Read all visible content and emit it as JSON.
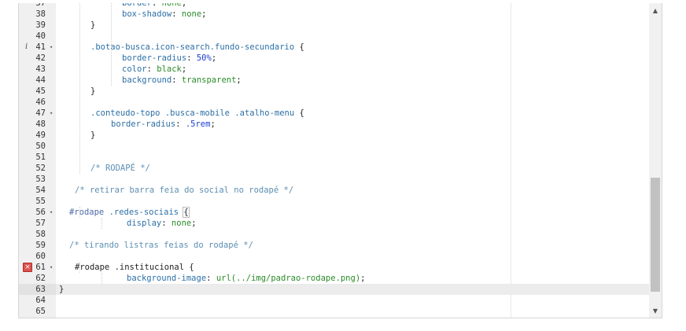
{
  "editor": {
    "first_line_partial": {
      "number": "37",
      "text": "border: none;"
    },
    "lines": [
      {
        "n": "38",
        "indent": 80,
        "tokens": [
          [
            "prop",
            "box-shadow"
          ],
          [
            "pun",
            ": "
          ],
          [
            "val",
            "none"
          ],
          [
            "pun",
            ";"
          ]
        ]
      },
      {
        "n": "39",
        "indent": 40,
        "tokens": [
          [
            "pun",
            "}"
          ]
        ]
      },
      {
        "n": "40",
        "indent": 0,
        "tokens": []
      },
      {
        "n": "41",
        "indent": 40,
        "fold": true,
        "info": true,
        "tokens": [
          [
            "sel",
            ".botao-busca.icon-search.fundo-secundario "
          ],
          [
            "pun",
            "{"
          ]
        ]
      },
      {
        "n": "42",
        "indent": 80,
        "tokens": [
          [
            "prop",
            "border-radius"
          ],
          [
            "pun",
            ": "
          ],
          [
            "num",
            "50%"
          ],
          [
            "pun",
            ";"
          ]
        ]
      },
      {
        "n": "43",
        "indent": 80,
        "tokens": [
          [
            "prop",
            "color"
          ],
          [
            "pun",
            ": "
          ],
          [
            "val",
            "black"
          ],
          [
            "pun",
            ";"
          ]
        ]
      },
      {
        "n": "44",
        "indent": 80,
        "tokens": [
          [
            "prop",
            "background"
          ],
          [
            "pun",
            ": "
          ],
          [
            "val",
            "transparent"
          ],
          [
            "pun",
            ";"
          ]
        ]
      },
      {
        "n": "45",
        "indent": 40,
        "tokens": [
          [
            "pun",
            "}"
          ]
        ]
      },
      {
        "n": "46",
        "indent": 0,
        "tokens": []
      },
      {
        "n": "47",
        "indent": 40,
        "fold": true,
        "tokens": [
          [
            "sel",
            ".conteudo-topo .busca-mobile .atalho-menu "
          ],
          [
            "pun",
            "{"
          ]
        ]
      },
      {
        "n": "48",
        "indent": 66,
        "tokens": [
          [
            "prop",
            "border-radius"
          ],
          [
            "pun",
            ": "
          ],
          [
            "num",
            ".5rem"
          ],
          [
            "pun",
            ";"
          ]
        ]
      },
      {
        "n": "49",
        "indent": 40,
        "tokens": [
          [
            "pun",
            "}"
          ]
        ]
      },
      {
        "n": "50",
        "indent": 0,
        "tokens": []
      },
      {
        "n": "51",
        "indent": 0,
        "tokens": []
      },
      {
        "n": "52",
        "indent": 40,
        "tokens": [
          [
            "com",
            "/* RODAPÉ */"
          ]
        ]
      },
      {
        "n": "53",
        "indent": 0,
        "tokens": []
      },
      {
        "n": "54",
        "indent": 20,
        "tokens": [
          [
            "com",
            "/* retirar barra feia do social no rodapé */"
          ]
        ]
      },
      {
        "n": "55",
        "indent": 0,
        "tokens": []
      },
      {
        "n": "56",
        "indent": 13,
        "fold": true,
        "tokens": [
          [
            "id",
            "#rodape"
          ],
          [
            "sel",
            " .redes-sociais "
          ],
          [
            "bracket",
            "{"
          ]
        ]
      },
      {
        "n": "57",
        "indent": 86,
        "tokens": [
          [
            "prop",
            "display"
          ],
          [
            "pun",
            ": "
          ],
          [
            "val",
            "none"
          ],
          [
            "pun",
            ";"
          ]
        ]
      },
      {
        "n": "58",
        "indent": 0,
        "tokens": []
      },
      {
        "n": "59",
        "indent": 13,
        "tokens": [
          [
            "com",
            "/* tirando listras feias do rodapé */"
          ]
        ]
      },
      {
        "n": "60",
        "indent": 0,
        "tokens": []
      },
      {
        "n": "61",
        "indent": 20,
        "fold": true,
        "error": true,
        "tokens": [
          [
            "pun",
            "#rodape .institucional {"
          ]
        ]
      },
      {
        "n": "62",
        "indent": 86,
        "tokens": [
          [
            "prop",
            "background-image"
          ],
          [
            "pun",
            ": "
          ],
          [
            "val",
            "url(../img/padrao-rodape.png)"
          ],
          [
            "pun",
            ";"
          ]
        ]
      },
      {
        "n": "63",
        "indent": 0,
        "active": true,
        "tokens": [
          [
            "pun",
            "}"
          ]
        ]
      },
      {
        "n": "64",
        "indent": 0,
        "tokens": []
      },
      {
        "n": "65",
        "indent": 0,
        "tokens": []
      }
    ],
    "gutter_icons": {
      "info": "i",
      "error": "×",
      "fold": "▾"
    },
    "scrollbar": {
      "up": "▲",
      "down": "▼",
      "thumb_start": 0.56,
      "thumb_end": 0.96
    }
  }
}
